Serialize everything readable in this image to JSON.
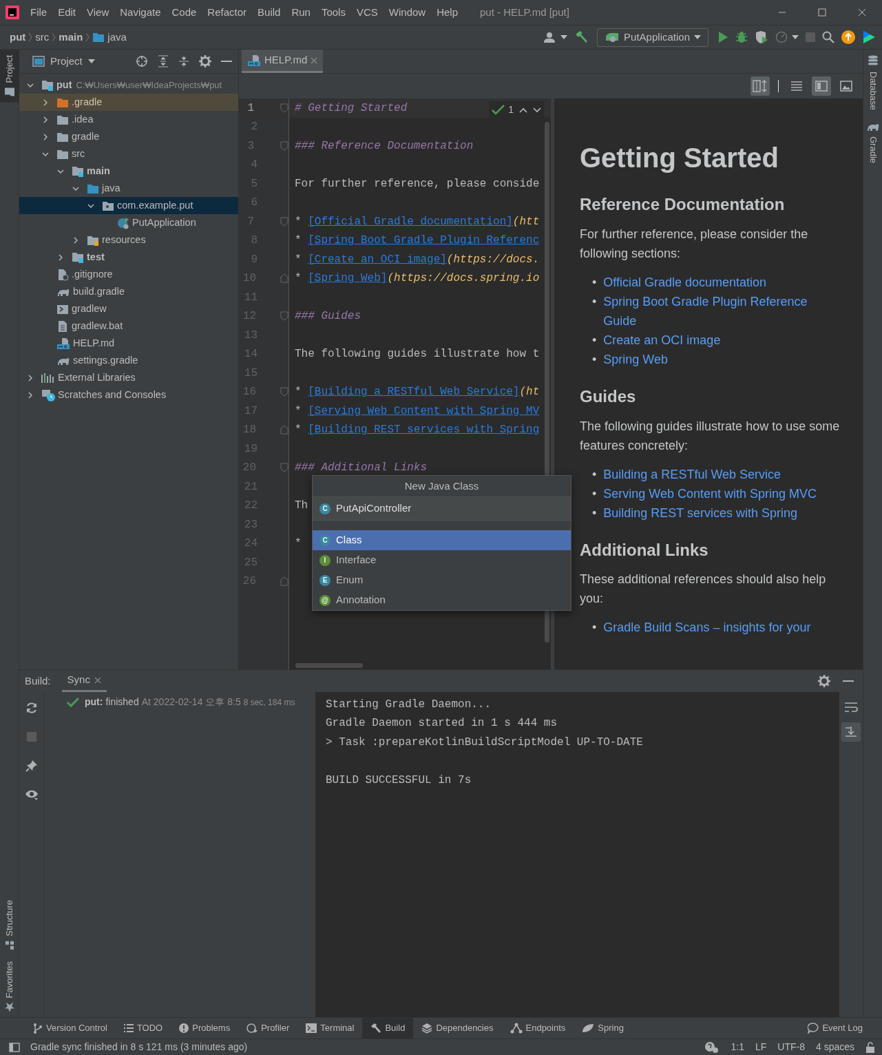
{
  "title_bar": {
    "menu": [
      "File",
      "Edit",
      "View",
      "Navigate",
      "Code",
      "Refactor",
      "Build",
      "Run",
      "Tools",
      "VCS",
      "Window",
      "Help"
    ],
    "title": "put - HELP.md [put]"
  },
  "breadcrumb": [
    {
      "label": "put",
      "kind": "module"
    },
    {
      "label": "src",
      "kind": "plain"
    },
    {
      "label": "main",
      "kind": "module"
    },
    {
      "label": "java",
      "kind": "source"
    }
  ],
  "toolbar": {
    "run_config": "PutApplication"
  },
  "left_stripe": {
    "top": [
      {
        "label": "Project",
        "selected": true
      }
    ],
    "bottom": [
      {
        "label": "Structure",
        "selected": false
      },
      {
        "label": "Favorites",
        "selected": false
      }
    ]
  },
  "project_panel": {
    "title": "Project",
    "tree": [
      {
        "label": "put",
        "hint": "C:₩Users₩user₩IdeaProjects₩put",
        "kind": "module",
        "expanded": true,
        "selected": false,
        "excluded": false,
        "children": [
          {
            "label": ".gradle",
            "kind": "folder",
            "expanded": false,
            "selected": false,
            "excluded": true
          },
          {
            "label": ".idea",
            "kind": "folder",
            "expanded": false,
            "selected": false,
            "excluded": false
          },
          {
            "label": "gradle",
            "kind": "folder",
            "expanded": false,
            "selected": false,
            "excluded": false
          },
          {
            "label": "src",
            "kind": "folder",
            "expanded": true,
            "selected": false,
            "excluded": false,
            "children": [
              {
                "label": "main",
                "kind": "module",
                "expanded": true,
                "selected": false,
                "excluded": false,
                "children": [
                  {
                    "label": "java",
                    "kind": "source",
                    "expanded": true,
                    "selected": false,
                    "excluded": false,
                    "children": [
                      {
                        "label": "com.example.put",
                        "kind": "package",
                        "expanded": true,
                        "selected": true,
                        "excluded": false,
                        "children": [
                          {
                            "label": "PutApplication",
                            "kind": "spring-class",
                            "selected": false,
                            "excluded": false
                          }
                        ]
                      }
                    ]
                  },
                  {
                    "label": "resources",
                    "kind": "resources",
                    "expanded": false,
                    "selected": false,
                    "excluded": false
                  }
                ]
              },
              {
                "label": "test",
                "kind": "module",
                "expanded": false,
                "selected": false,
                "excluded": false
              }
            ]
          },
          {
            "label": ".gitignore",
            "kind": "ignore-file",
            "selected": false,
            "excluded": false
          },
          {
            "label": "build.gradle",
            "kind": "gradle",
            "selected": false,
            "excluded": false
          },
          {
            "label": "gradlew",
            "kind": "shell",
            "selected": false,
            "excluded": false
          },
          {
            "label": "gradlew.bat",
            "kind": "text-file",
            "selected": false,
            "excluded": false
          },
          {
            "label": "HELP.md",
            "kind": "markdown",
            "selected": false,
            "excluded": false
          },
          {
            "label": "settings.gradle",
            "kind": "gradle",
            "selected": false,
            "excluded": false
          }
        ]
      },
      {
        "label": "External Libraries",
        "kind": "libraries",
        "expanded": false,
        "selected": false,
        "excluded": false
      },
      {
        "label": "Scratches and Consoles",
        "kind": "scratches",
        "expanded": false,
        "selected": false,
        "excluded": false
      }
    ]
  },
  "editor": {
    "tab": "HELP.md",
    "scroll_sync": {
      "on": true
    },
    "preview_modes": [
      {
        "kind": "editor",
        "selected": false
      },
      {
        "kind": "split",
        "selected": true
      },
      {
        "kind": "preview",
        "selected": false
      }
    ],
    "inspection_count": "1",
    "lines": [
      {
        "number": "1",
        "current": true,
        "fold": {
          "kind": "start"
        },
        "segments": [
          {
            "kind": "heading",
            "text": "# Getting Started"
          }
        ]
      },
      {
        "number": "2",
        "current": false
      },
      {
        "number": "3",
        "current": false,
        "fold": {
          "kind": "start"
        },
        "segments": [
          {
            "kind": "heading",
            "text": "### Reference Documentation"
          }
        ]
      },
      {
        "number": "4",
        "current": false
      },
      {
        "number": "5",
        "current": false,
        "segments": [
          {
            "kind": "text",
            "text": "For further reference, please conside"
          }
        ]
      },
      {
        "number": "6",
        "current": false
      },
      {
        "number": "7",
        "current": false,
        "fold": {
          "kind": "start"
        },
        "segments": [
          {
            "kind": "text",
            "text": "* "
          },
          {
            "kind": "link",
            "text": "[Official Gradle documentation]"
          },
          {
            "kind": "url",
            "text": "(htt"
          }
        ]
      },
      {
        "number": "8",
        "current": false,
        "segments": [
          {
            "kind": "text",
            "text": "* "
          },
          {
            "kind": "link",
            "text": "[Spring Boot Gradle Plugin Referenc"
          }
        ]
      },
      {
        "number": "9",
        "current": false,
        "segments": [
          {
            "kind": "text",
            "text": "* "
          },
          {
            "kind": "link",
            "text": "[Create an OCI image]"
          },
          {
            "kind": "url",
            "text": "(https://docs."
          }
        ]
      },
      {
        "number": "10",
        "current": false,
        "fold": {
          "kind": "end"
        },
        "segments": [
          {
            "kind": "text",
            "text": "* "
          },
          {
            "kind": "link",
            "text": "[Spring Web]"
          },
          {
            "kind": "url",
            "text": "(https://docs.spring.io"
          }
        ]
      },
      {
        "number": "11",
        "current": false
      },
      {
        "number": "12",
        "current": false,
        "fold": {
          "kind": "start"
        },
        "segments": [
          {
            "kind": "heading",
            "text": "### Guides"
          }
        ]
      },
      {
        "number": "13",
        "current": false
      },
      {
        "number": "14",
        "current": false,
        "segments": [
          {
            "kind": "text",
            "text": "The following guides illustrate how t"
          }
        ]
      },
      {
        "number": "15",
        "current": false
      },
      {
        "number": "16",
        "current": false,
        "fold": {
          "kind": "start"
        },
        "segments": [
          {
            "kind": "text",
            "text": "* "
          },
          {
            "kind": "link",
            "text": "[Building a RESTful Web Service]"
          },
          {
            "kind": "url",
            "text": "(ht"
          }
        ]
      },
      {
        "number": "17",
        "current": false,
        "segments": [
          {
            "kind": "text",
            "text": "* "
          },
          {
            "kind": "link",
            "text": "[Serving Web Content with Spring MV"
          }
        ]
      },
      {
        "number": "18",
        "current": false,
        "fold": {
          "kind": "end"
        },
        "segments": [
          {
            "kind": "text",
            "text": "* "
          },
          {
            "kind": "link",
            "text": "[Building REST services with Spring"
          }
        ]
      },
      {
        "number": "19",
        "current": false
      },
      {
        "number": "20",
        "current": false,
        "fold": {
          "kind": "start"
        },
        "segments": [
          {
            "kind": "heading",
            "text": "### Additional Links"
          }
        ]
      },
      {
        "number": "21",
        "current": false
      },
      {
        "number": "22",
        "current": false,
        "segments": [
          {
            "kind": "text",
            "text": "Th"
          }
        ]
      },
      {
        "number": "23",
        "current": false
      },
      {
        "number": "24",
        "current": false,
        "segments": [
          {
            "kind": "text",
            "text": "*"
          }
        ]
      },
      {
        "number": "25",
        "current": false
      },
      {
        "number": "26",
        "current": false,
        "fold": {
          "kind": "end"
        }
      }
    ],
    "preview": [
      {
        "kind": "h1",
        "text": "Getting Started"
      },
      {
        "kind": "h2",
        "text": "Reference Documentation"
      },
      {
        "kind": "p",
        "text": "For further reference, please consider the following sections:"
      },
      {
        "kind": "ul",
        "marker": "•",
        "items": [
          "Official Gradle documentation",
          "Spring Boot Gradle Plugin Reference Guide",
          "Create an OCI image",
          "Spring Web"
        ]
      },
      {
        "kind": "h2",
        "text": "Guides"
      },
      {
        "kind": "p",
        "text": "The following guides illustrate how to use some features concretely:"
      },
      {
        "kind": "ul",
        "marker": "•",
        "items": [
          "Building a RESTful Web Service",
          "Serving Web Content with Spring MVC",
          "Building REST services with Spring"
        ]
      },
      {
        "kind": "h2",
        "text": "Additional Links"
      },
      {
        "kind": "p",
        "text": "These additional references should also help you:"
      },
      {
        "kind": "ul",
        "marker": "•",
        "items": [
          "Gradle Build Scans – insights for your"
        ]
      }
    ]
  },
  "popup": {
    "title": "New Java Class",
    "badge": "C",
    "value": "PutApiController",
    "options": [
      {
        "label": "Class",
        "badge": "C",
        "color": "#3e86a0",
        "selected": true
      },
      {
        "label": "Interface",
        "badge": "I",
        "color": "#5f8c3a",
        "selected": false
      },
      {
        "label": "Enum",
        "badge": "E",
        "color": "#3e86a0",
        "selected": false
      },
      {
        "label": "Annotation",
        "badge": "@",
        "color": "#5f8c3a",
        "selected": false
      }
    ]
  },
  "right_stripe": [
    {
      "label": "Database",
      "kind": "database"
    },
    {
      "label": "Gradle",
      "kind": "gradle"
    }
  ],
  "build_panel": {
    "label": "Build:",
    "tab": "Sync",
    "result": {
      "name": "put:",
      "status": "finished",
      "time": "At 2022-02-14 오후 8:5",
      "duration": "8 sec, 184 ms"
    },
    "console": [
      [
        "Starting Gradle Daemon...",
        "Gradle Daemon started in 1 s 444 ms",
        "> Task :prepareKotlinBuildScriptModel UP-TO-DATE"
      ],
      [
        "BUILD SUCCESSFUL in 7s"
      ]
    ]
  },
  "tool_tabs": [
    {
      "label": "Version Control",
      "kind": "vcs",
      "selected": false
    },
    {
      "label": "TODO",
      "kind": "todo",
      "selected": false
    },
    {
      "label": "Problems",
      "kind": "problems",
      "selected": false
    },
    {
      "label": "Profiler",
      "kind": "profiler",
      "selected": false
    },
    {
      "label": "Terminal",
      "kind": "terminal",
      "selected": false
    },
    {
      "label": "Build",
      "kind": "build",
      "selected": true
    },
    {
      "label": "Dependencies",
      "kind": "dependencies",
      "selected": false
    },
    {
      "label": "Endpoints",
      "kind": "endpoints",
      "selected": false
    },
    {
      "label": "Spring",
      "kind": "spring",
      "selected": false
    }
  ],
  "event_log": "Event Log",
  "status_bar": {
    "message": "Gradle sync finished in 8 s 121 ms (3 minutes ago)",
    "items": [
      "1:1",
      "LF",
      "UTF-8",
      "4 spaces"
    ]
  }
}
